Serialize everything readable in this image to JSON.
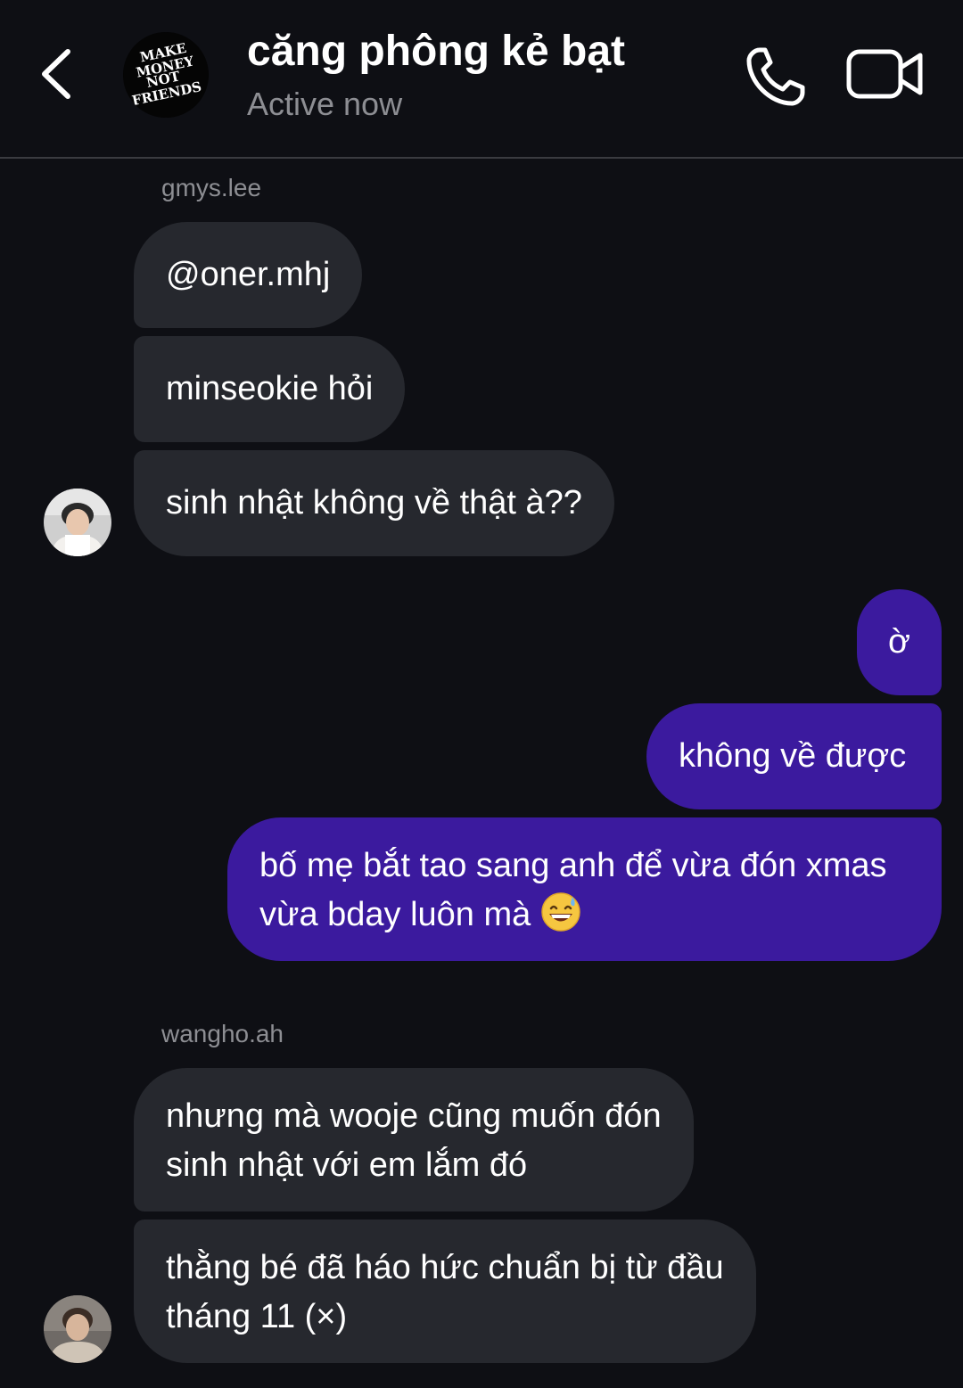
{
  "header": {
    "title": "căng phông kẻ bạt",
    "status": "Active now",
    "group_avatar_text": [
      "MAKE",
      "MONEY",
      "NOT",
      "FRIENDS"
    ]
  },
  "messages": {
    "group1": {
      "sender": "gmys.lee",
      "m1": "@oner.mhj",
      "m2": "minseokie hỏi",
      "m3": "sinh nhật không về thật à??"
    },
    "group2": {
      "m1": "ờ",
      "m2": "không về được",
      "m3_line1": "bố mẹ bắt tao sang anh để vừa đón xmas",
      "m3_line2": "vừa bday luôn mà"
    },
    "group3": {
      "sender": "wangho.ah",
      "m1_line1": "nhưng mà wooje cũng muốn đón",
      "m1_line2": "sinh nhật với em lắm đó",
      "m2_line1": "thằng bé đã háo hức chuẩn bị từ đầu",
      "m2_line2": "tháng 11 (×)"
    }
  },
  "colors": {
    "background": "#0e0f14",
    "incoming_bubble": "#26282e",
    "outgoing_bubble": "#3b1a9e",
    "secondary_text": "#8d8e93"
  },
  "icons": {
    "back": "chevron-left-icon",
    "call": "phone-icon",
    "video": "video-camera-icon",
    "emoji": "grinning-face-with-sweat-emoji"
  }
}
